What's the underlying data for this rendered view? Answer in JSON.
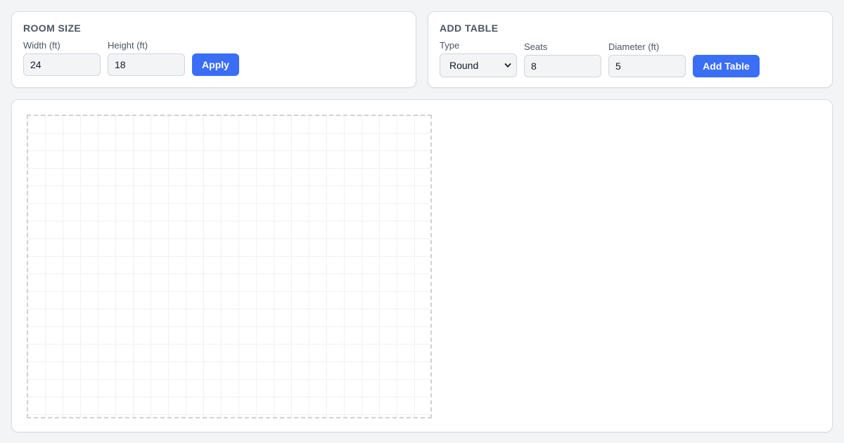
{
  "room_size": {
    "title": "ROOM SIZE",
    "width_label": "Width (ft)",
    "width_value": "24",
    "height_label": "Height (ft)",
    "height_value": "18",
    "apply_label": "Apply"
  },
  "add_table": {
    "title": "ADD TABLE",
    "type_label": "Type",
    "type_value": "Round",
    "seats_label": "Seats",
    "seats_value": "8",
    "diameter_label": "Diameter (ft)",
    "diameter_value": "5",
    "add_label": "Add Table"
  },
  "icons": {
    "select_chevron": "chevron-down-icon"
  },
  "colors": {
    "accent": "#3b6ef6",
    "page_background": "#f3f4f6",
    "panel_background": "#ffffff",
    "grid_line": "#f0f1f3",
    "room_border": "#cfd2d6"
  }
}
